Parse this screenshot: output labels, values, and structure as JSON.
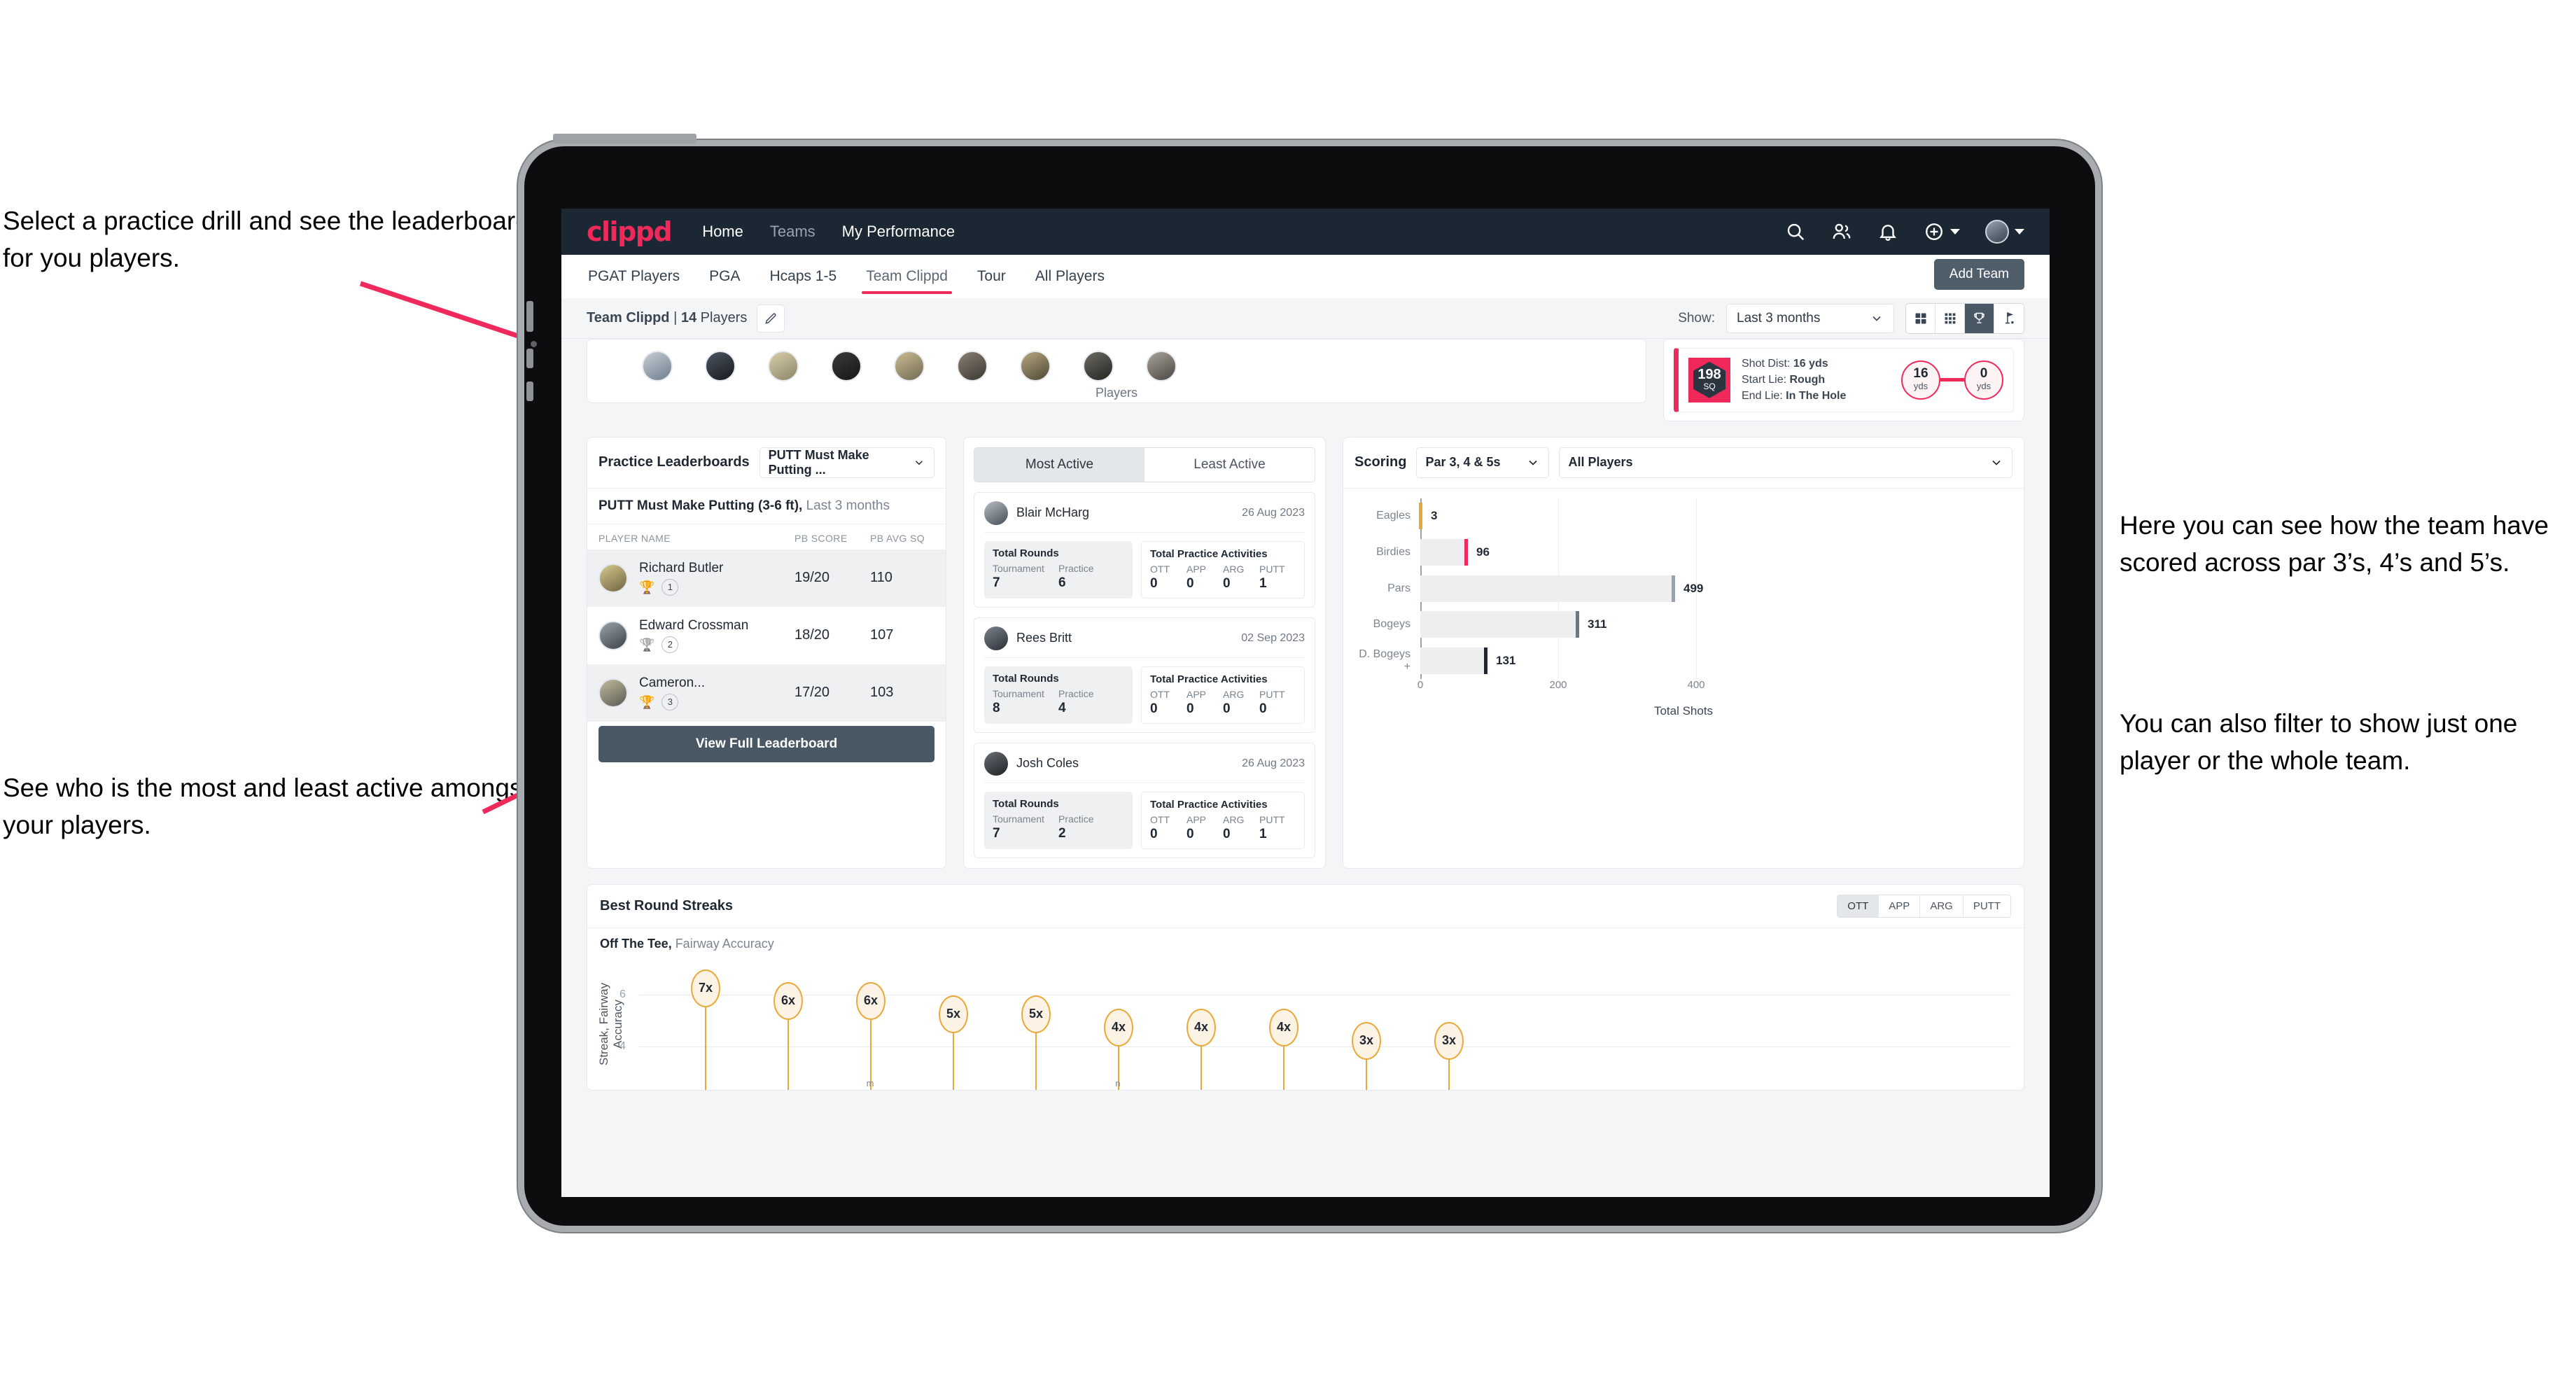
{
  "annotations": {
    "top_left": "Select a practice drill and see the leaderboard for you players.",
    "bottom_left": "See who is the most and least active amongst your players.",
    "right_1": "Here you can see how the team have scored across par 3’s, 4’s and 5’s.",
    "right_2": "You can also filter to show just one player or the whole team."
  },
  "colors": {
    "brand": "#ef2a5b",
    "navbar": "#1b2733",
    "dark_button": "#4a5764",
    "gold": "#e8a93a"
  },
  "topnav": {
    "logo": "clippd",
    "links": [
      {
        "label": "Home",
        "active": true
      },
      {
        "label": "Teams",
        "active": false
      },
      {
        "label": "My Performance",
        "active": true
      }
    ],
    "icons": [
      "search-icon",
      "people-icon",
      "bell-icon",
      "plus-circle-icon",
      "avatar"
    ]
  },
  "tabs": [
    {
      "label": "PGAT Players",
      "active": false
    },
    {
      "label": "PGA",
      "active": false
    },
    {
      "label": "Hcaps 1-5",
      "active": false
    },
    {
      "label": "Team Clippd",
      "active": true
    },
    {
      "label": "Tour",
      "active": false
    },
    {
      "label": "All Players",
      "active": false
    }
  ],
  "add_team_label": "Add Team",
  "subbar": {
    "team_name": "Team Clippd",
    "separator": " | ",
    "player_count": "14",
    "players_word": "Players",
    "show_label": "Show:",
    "show_value": "Last 3 months",
    "view_toggles": [
      {
        "name": "grid-large-icon",
        "active": false
      },
      {
        "name": "grid-small-icon",
        "active": false
      },
      {
        "name": "trophy-icon",
        "active": true
      },
      {
        "name": "flag-icon",
        "active": false
      }
    ]
  },
  "player_strip": {
    "caption": "Players",
    "avatar_count": 9
  },
  "shot_card": {
    "sq_value": "198",
    "sq_unit": "SQ",
    "lines": [
      {
        "label": "Shot Dist:",
        "value": "16 yds"
      },
      {
        "label": "Start Lie:",
        "value": "Rough"
      },
      {
        "label": "End Lie:",
        "value": "In The Hole"
      }
    ],
    "start_value": "16",
    "start_unit": "yds",
    "end_value": "0",
    "end_unit": "yds"
  },
  "leaderboard": {
    "title": "Practice Leaderboards",
    "drill_select": "PUTT Must Make Putting ...",
    "subtitle_bold": "PUTT Must Make Putting (3-6 ft),",
    "subtitle_muted": " Last 3 months",
    "columns": [
      "PLAYER NAME",
      "PB SCORE",
      "PB AVG SQ"
    ],
    "rows": [
      {
        "name": "Richard Butler",
        "rank": "1",
        "trophy": "gold",
        "score": "19/20",
        "avg": "110",
        "highlight": true
      },
      {
        "name": "Edward Crossman",
        "rank": "2",
        "trophy": "silver",
        "score": "18/20",
        "avg": "107",
        "highlight": false
      },
      {
        "name": "Cameron...",
        "rank": "3",
        "trophy": "bronze",
        "score": "17/20",
        "avg": "103",
        "highlight": true
      }
    ],
    "view_full_label": "View Full Leaderboard"
  },
  "activity": {
    "tabs": [
      {
        "label": "Most Active",
        "active": true
      },
      {
        "label": "Least Active",
        "active": false
      }
    ],
    "rounds_title": "Total Rounds",
    "rounds_cols": [
      "Tournament",
      "Practice"
    ],
    "practice_title": "Total Practice Activities",
    "practice_cols": [
      "OTT",
      "APP",
      "ARG",
      "PUTT"
    ],
    "cards": [
      {
        "name": "Blair McHarg",
        "date": "26 Aug 2023",
        "tournament": "7",
        "practice": "6",
        "ott": "0",
        "app": "0",
        "arg": "0",
        "putt": "1"
      },
      {
        "name": "Rees Britt",
        "date": "02 Sep 2023",
        "tournament": "8",
        "practice": "4",
        "ott": "0",
        "app": "0",
        "arg": "0",
        "putt": "0"
      },
      {
        "name": "Josh Coles",
        "date": "26 Aug 2023",
        "tournament": "7",
        "practice": "2",
        "ott": "0",
        "app": "0",
        "arg": "0",
        "putt": "1"
      }
    ]
  },
  "scoring": {
    "title": "Scoring",
    "par_select": "Par 3, 4 & 5s",
    "player_select": "All Players"
  },
  "streaks": {
    "title": "Best Round Streaks",
    "toggles": [
      {
        "label": "OTT",
        "active": true
      },
      {
        "label": "APP",
        "active": false
      },
      {
        "label": "ARG",
        "active": false
      },
      {
        "label": "PUTT",
        "active": false
      }
    ],
    "subtitle_bold": "Off The Tee,",
    "subtitle_muted": " Fairway Accuracy"
  },
  "chart_data": [
    {
      "type": "bar",
      "orientation": "horizontal",
      "title": "Scoring",
      "categories": [
        "Eagles",
        "Birdies",
        "Pars",
        "Bogeys",
        "D. Bogeys +"
      ],
      "values": [
        3,
        96,
        499,
        311,
        131
      ],
      "cap_colors": [
        "#e8a93a",
        "#ef2a5b",
        "#9aa3ac",
        "#6b7681",
        "#1f2832"
      ],
      "xlabel": "Total Shots",
      "ylabel": "",
      "xticks": [
        0,
        200,
        400
      ],
      "xlim": [
        0,
        540
      ],
      "grid": true,
      "legend": "none"
    },
    {
      "type": "bar",
      "orientation": "vertical",
      "title": "Best Round Streaks",
      "subtitle": "Off The Tee, Fairway Accuracy",
      "categories": [
        "",
        "",
        "",
        "",
        "",
        "",
        "",
        "",
        "",
        ""
      ],
      "values": [
        7,
        6,
        6,
        5,
        5,
        4,
        4,
        4,
        3,
        3
      ],
      "labels": [
        "7x",
        "6x",
        "6x",
        "5x",
        "5x",
        "4x",
        "4x",
        "4x",
        "3x",
        "3x"
      ],
      "ylabel": "Streak, Fairway Accuracy",
      "xlabel": "",
      "yticks": [
        4,
        6
      ],
      "ylim": [
        0,
        8
      ],
      "grid": true,
      "legend": "none"
    }
  ]
}
